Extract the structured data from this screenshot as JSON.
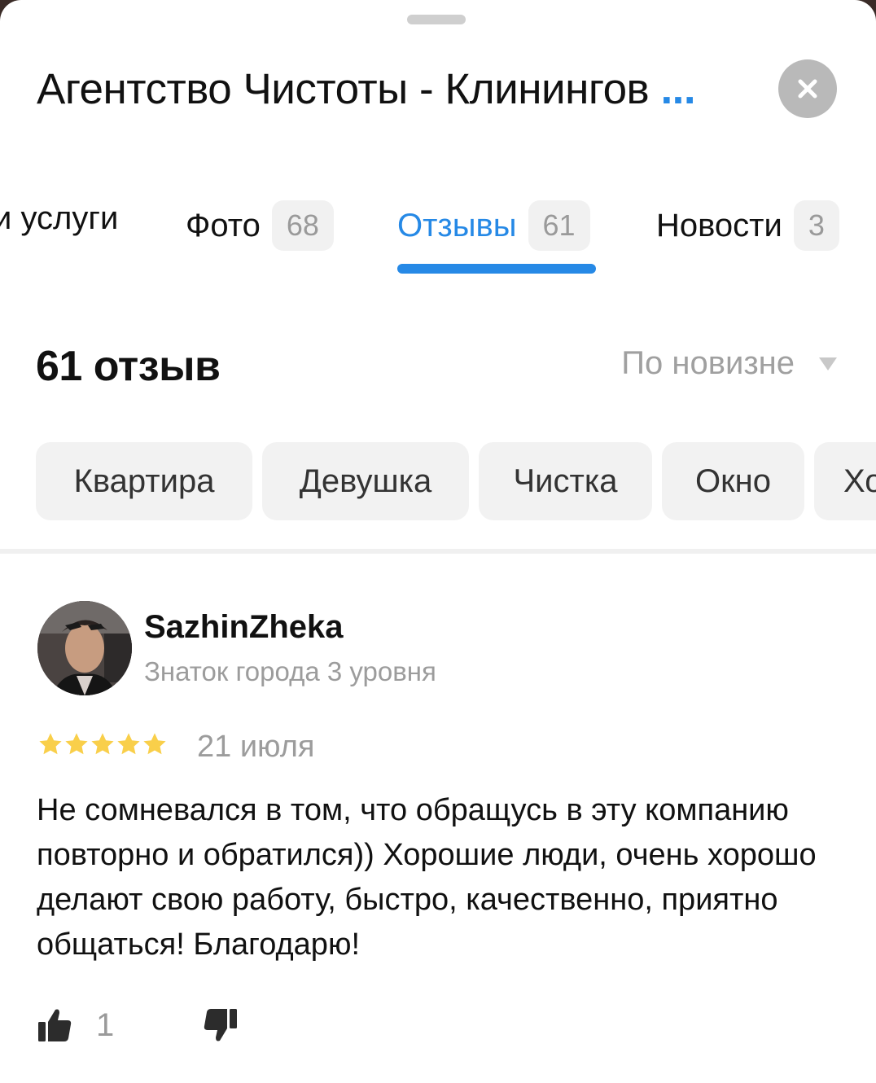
{
  "header": {
    "title": "Агентство Чистоты - Клинингов",
    "title_more": "...",
    "close_icon": "close-icon"
  },
  "tabs": [
    {
      "label": "и услуги",
      "badge": ""
    },
    {
      "label": "Фото",
      "badge": "68"
    },
    {
      "label": "Отзывы",
      "badge": "61",
      "active": true
    },
    {
      "label": "Новости",
      "badge": "3"
    }
  ],
  "reviews": {
    "count_label": "61 отзыв",
    "sort_label": "По новизне"
  },
  "chips": [
    "Квартира",
    "Девушка",
    "Чистка",
    "Окно",
    "Хо"
  ],
  "review": {
    "author": "SazhinZheka",
    "level": "Знаток города 3 уровня",
    "rating": 5,
    "date": "21 июля",
    "text": "Не сомневался в том, что обращусь в эту компанию повторно и обратился)) Хорошие люди, очень хорошо делают свою работу, быстро, качественно, приятно общаться! Благодарю!",
    "likes": "1"
  },
  "colors": {
    "accent": "#2689e6",
    "star": "#f9cf4a",
    "muted": "#9c9c9c"
  }
}
